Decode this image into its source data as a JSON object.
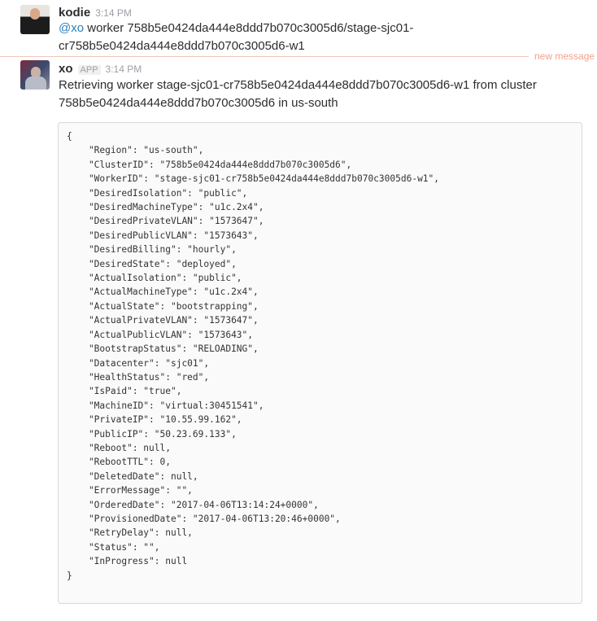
{
  "messages": [
    {
      "author": "kodie",
      "time": "3:14 PM",
      "mention": "@xo",
      "text": " worker 758b5e0424da444e8ddd7b070c3005d6/stage-sjc01-cr758b5e0424da444e8ddd7b070c3005d6-w1"
    },
    {
      "author": "xo",
      "badge": "APP",
      "time": "3:14 PM",
      "text": "Retrieving worker stage-sjc01-cr758b5e0424da444e8ddd7b070c3005d6-w1 from cluster 758b5e0424da444e8ddd7b070c3005d6 in us-south",
      "code_lines": [
        "{",
        "    \"Region\": \"us-south\",",
        "    \"ClusterID\": \"758b5e0424da444e8ddd7b070c3005d6\",",
        "    \"WorkerID\": \"stage-sjc01-cr758b5e0424da444e8ddd7b070c3005d6-w1\",",
        "    \"DesiredIsolation\": \"public\",",
        "    \"DesiredMachineType\": \"u1c.2x4\",",
        "    \"DesiredPrivateVLAN\": \"1573647\",",
        "    \"DesiredPublicVLAN\": \"1573643\",",
        "    \"DesiredBilling\": \"hourly\",",
        "    \"DesiredState\": \"deployed\",",
        "    \"ActualIsolation\": \"public\",",
        "    \"ActualMachineType\": \"u1c.2x4\",",
        "    \"ActualState\": \"bootstrapping\",",
        "    \"ActualPrivateVLAN\": \"1573647\",",
        "    \"ActualPublicVLAN\": \"1573643\",",
        "    \"BootstrapStatus\": \"RELOADING\",",
        "    \"Datacenter\": \"sjc01\",",
        "    \"HealthStatus\": \"red\",",
        "    \"IsPaid\": \"true\",",
        "    \"MachineID\": \"virtual:30451541\",",
        "    \"PrivateIP\": \"10.55.99.162\",",
        "    \"PublicIP\": \"50.23.69.133\",",
        "    \"Reboot\": null,",
        "    \"RebootTTL\": 0,",
        "    \"DeletedDate\": null,",
        "    \"ErrorMessage\": \"\",",
        "    \"OrderedDate\": \"2017-04-06T13:14:24+0000\",",
        "    \"ProvisionedDate\": \"2017-04-06T13:20:46+0000\",",
        "    \"RetryDelay\": null,",
        "    \"Status\": \"\",",
        "    \"InProgress\": null",
        "}"
      ]
    }
  ],
  "divider_label": "new message",
  "colors": {
    "mention": "#2a80b9",
    "new_message": "#f2a08e"
  }
}
